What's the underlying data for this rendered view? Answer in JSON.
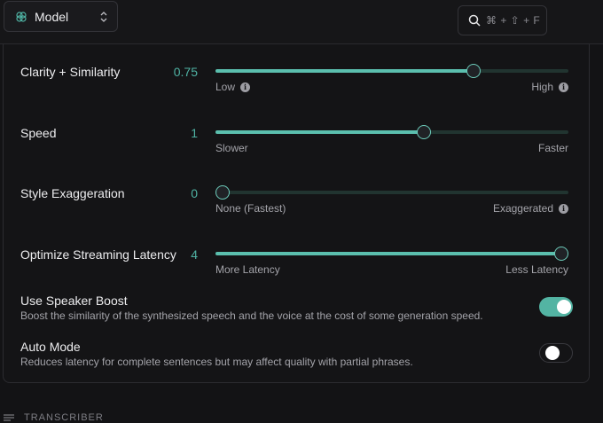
{
  "header": {
    "model_label": "Model",
    "model_icon": "brain-icon",
    "search_shortcut": "⌘ + ⇧ + F",
    "search_icon": "search-icon"
  },
  "sliders": [
    {
      "label": "Clarity + Similarity",
      "value": "0.75",
      "fraction": 0.74,
      "min_hint": "Low",
      "max_hint": "High",
      "min_info": true,
      "max_info": true
    },
    {
      "label": "Speed",
      "value": "1",
      "fraction": 0.595,
      "min_hint": "Slower",
      "max_hint": "Faster",
      "min_info": false,
      "max_info": false
    },
    {
      "label": "Style Exaggeration",
      "value": "0",
      "fraction": 0.0,
      "min_hint": "None (Fastest)",
      "max_hint": "Exaggerated",
      "min_info": false,
      "max_info": true
    },
    {
      "label": "Optimize Streaming Latency",
      "value": "4",
      "fraction": 1.0,
      "min_hint": "More Latency",
      "max_hint": "Less Latency",
      "min_info": false,
      "max_info": false
    }
  ],
  "toggles": [
    {
      "title": "Use Speaker Boost",
      "description": "Boost the similarity of the synthesized speech and the voice at the cost of some generation speed.",
      "on": true
    },
    {
      "title": "Auto Mode",
      "description": "Reduces latency for complete sentences but may affect quality with partial phrases.",
      "on": false
    }
  ],
  "footer": {
    "section_label": "TRANSCRIBER"
  },
  "colors": {
    "accent": "#5bbfae",
    "track": "#213430",
    "background": "#131315"
  }
}
